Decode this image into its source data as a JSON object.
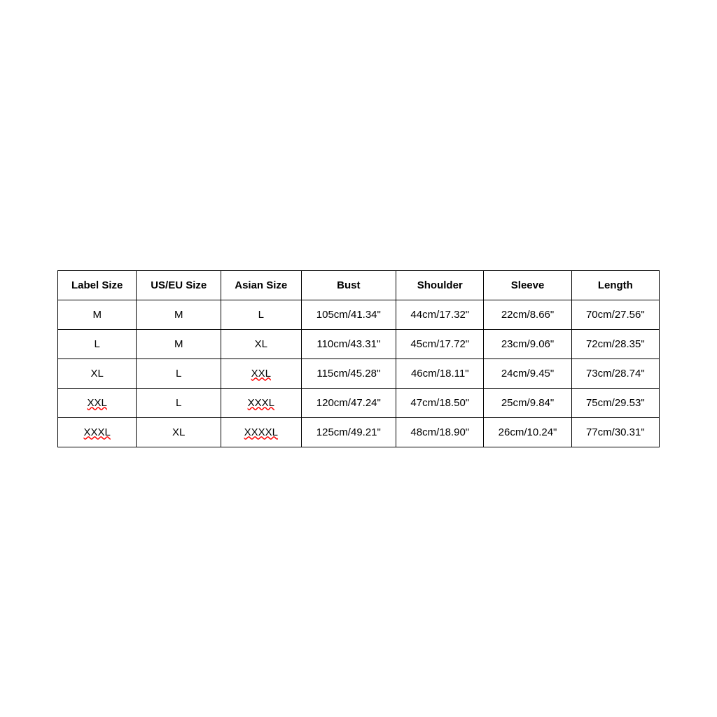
{
  "table": {
    "headers": [
      "Label Size",
      "US/EU Size",
      "Asian Size",
      "Bust",
      "Shoulder",
      "Sleeve",
      "Length"
    ],
    "rows": [
      {
        "label_size": "M",
        "us_eu_size": "M",
        "asian_size": "L",
        "bust": "105cm/41.34\"",
        "shoulder": "44cm/17.32\"",
        "sleeve": "22cm/8.66\"",
        "length": "70cm/27.56\""
      },
      {
        "label_size": "L",
        "us_eu_size": "M",
        "asian_size": "XL",
        "bust": "110cm/43.31\"",
        "shoulder": "45cm/17.72\"",
        "sleeve": "23cm/9.06\"",
        "length": "72cm/28.35\""
      },
      {
        "label_size": "XL",
        "us_eu_size": "L",
        "asian_size": "XXL",
        "bust": "115cm/45.28\"",
        "shoulder": "46cm/18.11\"",
        "sleeve": "24cm/9.45\"",
        "length": "73cm/28.74\""
      },
      {
        "label_size": "XXL",
        "us_eu_size": "L",
        "asian_size": "XXXL",
        "bust": "120cm/47.24\"",
        "shoulder": "47cm/18.50\"",
        "sleeve": "25cm/9.84\"",
        "length": "75cm/29.53\""
      },
      {
        "label_size": "XXXL",
        "us_eu_size": "XL",
        "asian_size": "XXXXL",
        "bust": "125cm/49.21\"",
        "shoulder": "48cm/18.90\"",
        "sleeve": "26cm/10.24\"",
        "length": "77cm/30.31\""
      }
    ]
  }
}
